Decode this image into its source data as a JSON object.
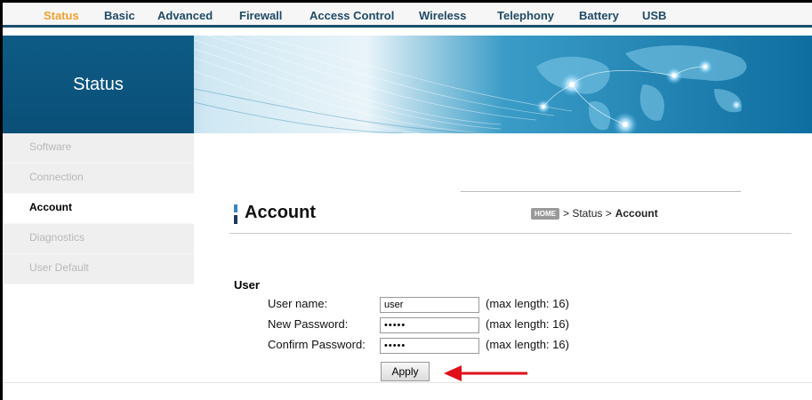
{
  "nav": {
    "items": [
      "Status",
      "Basic",
      "Advanced",
      "Firewall",
      "Access Control",
      "Wireless",
      "Telephony",
      "Battery",
      "USB"
    ],
    "active": "Status"
  },
  "banner": {
    "title": "Status"
  },
  "sidebar": {
    "items": [
      {
        "label": "Software",
        "active": false
      },
      {
        "label": "Connection",
        "active": false
      },
      {
        "label": "Account",
        "active": true
      },
      {
        "label": "Diagnostics",
        "active": false
      },
      {
        "label": "User Default",
        "active": false
      }
    ]
  },
  "page": {
    "title": "Account",
    "breadcrumb": {
      "home": "HOME",
      "trail": "> Status >",
      "current": "Account"
    }
  },
  "form": {
    "section_title": "User",
    "username": {
      "label": "User name:",
      "value": "user",
      "hint": "(max length: 16)"
    },
    "new_password": {
      "label": "New Password:",
      "value": "•••••",
      "hint": "(max length: 16)"
    },
    "confirm_password": {
      "label": "Confirm Password:",
      "value": "•••••",
      "hint": "(max length: 16)"
    },
    "apply_label": "Apply"
  },
  "colors": {
    "nav_active": "#f0a030",
    "nav_text": "#1f4a66",
    "banner": "#1a6d95",
    "arrow": "#e0101a"
  }
}
